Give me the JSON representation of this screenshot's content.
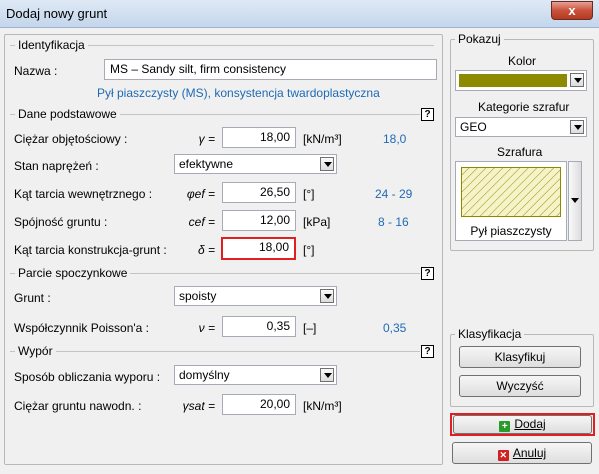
{
  "window": {
    "title": "Dodaj nowy grunt",
    "close_glyph": "x"
  },
  "ident": {
    "heading": "Identyfikacja",
    "name_label": "Nazwa :",
    "name_value": "MS – Sandy silt, firm consistency",
    "description": "Pył piaszczysty (MS), konsystencja twardoplastyczna"
  },
  "basic": {
    "heading": "Dane podstawowe",
    "unit_weight": {
      "label": "Ciężar objętościowy :",
      "symbol": "γ =",
      "value": "18,00",
      "unit": "[kN/m³]",
      "ref": "18,0"
    },
    "stress_state": {
      "label": "Stan naprężeń :",
      "value": "efektywne"
    },
    "friction_angle": {
      "label": "Kąt tarcia wewnętrznego :",
      "symbol": "φef =",
      "value": "26,50",
      "unit": "[°]",
      "ref": "24 - 29"
    },
    "cohesion": {
      "label": "Spójność gruntu :",
      "symbol": "cef =",
      "value": "12,00",
      "unit": "[kPa]",
      "ref": "8 - 16"
    },
    "structure_friction": {
      "label": "Kąt tarcia konstrukcja-grunt :",
      "symbol": "δ =",
      "value": "18,00",
      "unit": "[°]"
    }
  },
  "rest": {
    "heading": "Parcie spoczynkowe",
    "soil": {
      "label": "Grunt :",
      "value": "spoisty"
    },
    "poisson": {
      "label": "Współczynnik Poisson'a :",
      "symbol": "ν =",
      "value": "0,35",
      "unit": "[–]",
      "ref": "0,35"
    }
  },
  "uplift": {
    "heading": "Wypór",
    "method": {
      "label": "Sposób obliczania wyporu :",
      "value": "domyślny"
    },
    "sat_weight": {
      "label": "Ciężar gruntu nawodn. :",
      "symbol": "γsat =",
      "value": "20,00",
      "unit": "[kN/m³]"
    }
  },
  "show": {
    "heading": "Pokazuj",
    "color_label": "Kolor",
    "color_value": "#8b8a00",
    "hatch_category_label": "Kategorie szrafur",
    "hatch_category_value": "GEO",
    "hatch_label": "Szrafura",
    "hatch_name": "Pył piaszczysty"
  },
  "classification": {
    "heading": "Klasyfikacja",
    "classify_button": "Klasyfikuj",
    "clear_button": "Wyczyść"
  },
  "actions": {
    "add_button": "Dodaj",
    "cancel_button": "Anuluj"
  },
  "help_glyph": "?"
}
